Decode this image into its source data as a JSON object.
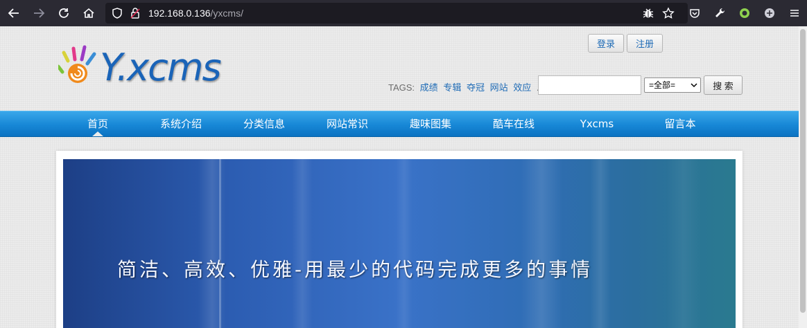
{
  "browser": {
    "url_host": "192.168.0.136",
    "url_path": "/yxcms/"
  },
  "site": {
    "logo_text": "Y.xcms",
    "login_label": "登录",
    "register_label": "注册",
    "tags_label": "TAGS:",
    "tags": [
      "成绩",
      "专辑",
      "夺冠",
      "网站",
      "效应"
    ],
    "tags_more": "...",
    "search_placeholder": "",
    "search_select": "=全部=",
    "search_button": "搜 索"
  },
  "nav": {
    "items": [
      "首页",
      "系统介绍",
      "分类信息",
      "网站常识",
      "趣味图集",
      "酷车在线",
      "Yxcms",
      "留言本"
    ],
    "active": "首页"
  },
  "banner": {
    "headline": "简洁、高效、优雅-用最少的代码完成更多的事情"
  },
  "colors": {
    "nav_blue": "#1787d6",
    "link_blue": "#1d6ab5",
    "chrome_dark": "#2b2a33"
  }
}
